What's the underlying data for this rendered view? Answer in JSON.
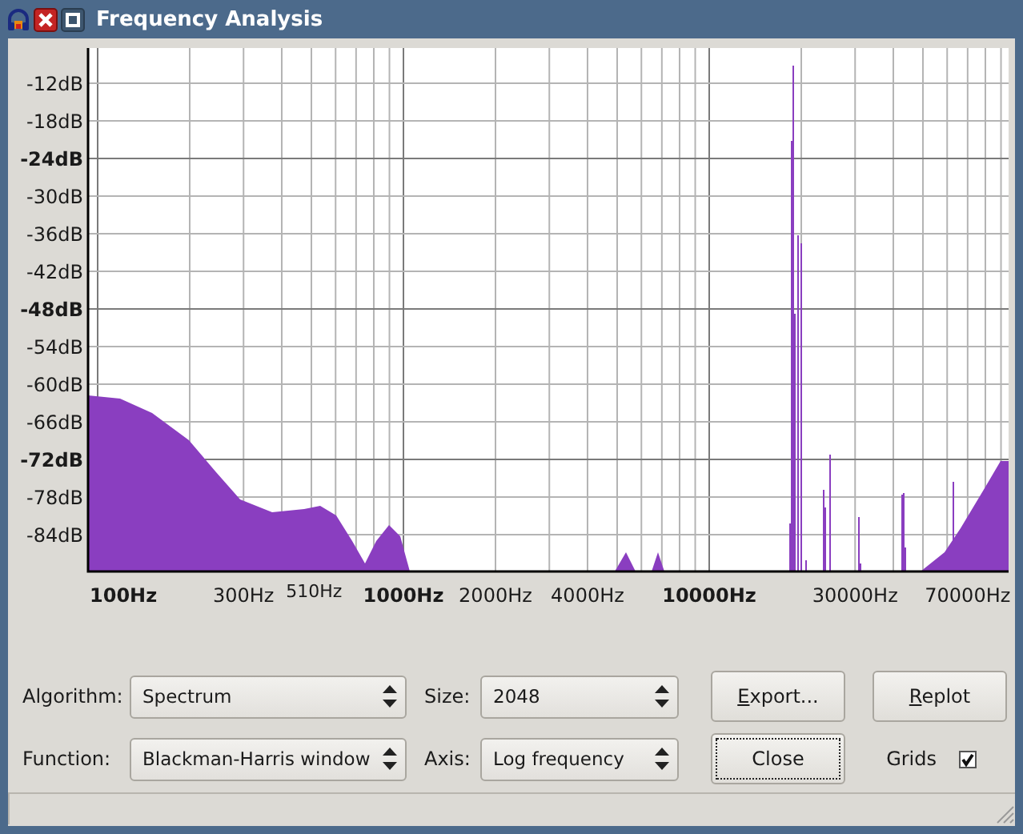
{
  "window": {
    "title": "Frequency Analysis"
  },
  "plot": {
    "y_ticks": [
      {
        "label": "-12dB",
        "bold": false
      },
      {
        "label": "-18dB",
        "bold": false
      },
      {
        "label": "-24dB",
        "bold": true
      },
      {
        "label": "-30dB",
        "bold": false
      },
      {
        "label": "-36dB",
        "bold": false
      },
      {
        "label": "-42dB",
        "bold": false
      },
      {
        "label": "-48dB",
        "bold": true
      },
      {
        "label": "-54dB",
        "bold": false
      },
      {
        "label": "-60dB",
        "bold": false
      },
      {
        "label": "-66dB",
        "bold": false
      },
      {
        "label": "-72dB",
        "bold": true
      },
      {
        "label": "-78dB",
        "bold": false
      },
      {
        "label": "-84dB",
        "bold": false
      }
    ],
    "x_ticks": [
      {
        "label": "100Hz",
        "kind": "decade"
      },
      {
        "label": "300Hz",
        "kind": "regular"
      },
      {
        "label": "510Hz",
        "kind": "marker"
      },
      {
        "label": "1000Hz",
        "kind": "decade"
      },
      {
        "label": "2000Hz",
        "kind": "regular"
      },
      {
        "label": "4000Hz",
        "kind": "regular"
      },
      {
        "label": "10000Hz",
        "kind": "decade"
      },
      {
        "label": "30000Hz",
        "kind": "regular"
      },
      {
        "label": "70000Hz",
        "kind": "regular"
      }
    ]
  },
  "controls": [
    {
      "label": "Algorithm:",
      "value": "Spectrum"
    },
    {
      "label": "Size:",
      "value": "2048"
    },
    {
      "label": "Function:",
      "value": "Blackman-Harris window"
    },
    {
      "label": "Axis:",
      "value": "Log frequency"
    }
  ],
  "buttons": [
    {
      "label": "Export...",
      "mnemonic": true,
      "focused": false
    },
    {
      "label": "Replot",
      "mnemonic": true,
      "focused": false
    },
    {
      "label": "Close",
      "mnemonic": false,
      "focused": true
    }
  ],
  "grids": {
    "label": "Grids",
    "checked": true
  }
}
